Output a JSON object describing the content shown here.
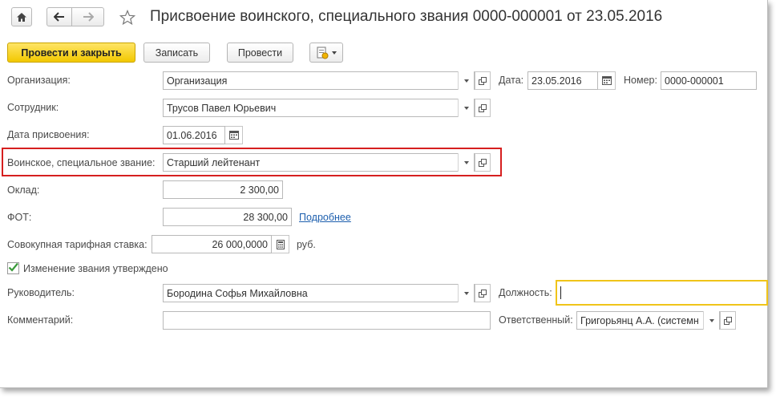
{
  "window": {
    "title": "Присвоение воинского, специального звания 0000-000001 от 23.05.2016"
  },
  "nav": {
    "home_icon": "home-icon",
    "back_icon": "arrow-left-icon",
    "forward_icon": "arrow-right-icon",
    "favorite_icon": "star-icon"
  },
  "toolbar": {
    "post_close_label": "Провести и закрыть",
    "save_label": "Записать",
    "post_label": "Провести",
    "reports_icon": "document-menu-icon"
  },
  "form": {
    "organization": {
      "label": "Организация:",
      "value": "Организация"
    },
    "date": {
      "label": "Дата:",
      "value": "23.05.2016"
    },
    "number": {
      "label": "Номер:",
      "value": "0000-000001"
    },
    "employee": {
      "label": "Сотрудник:",
      "value": "Трусов Павел Юрьевич"
    },
    "assign_date": {
      "label": "Дата присвоения:",
      "value": "01.06.2016"
    },
    "rank": {
      "label": "Воинское, специальное звание:",
      "value": "Старший лейтенант"
    },
    "salary": {
      "label": "Оклад:",
      "value": "2 300,00"
    },
    "fot": {
      "label": "ФОТ:",
      "value": "28 300,00",
      "link": "Подробнее"
    },
    "tariff": {
      "label": "Совокупная тарифная ставка:",
      "value": "26 000,0000",
      "unit": "руб."
    },
    "rank_change": {
      "label": "Изменение звания утверждено",
      "checked": true
    },
    "manager": {
      "label": "Руководитель:",
      "value": "Бородина Софья Михайловна"
    },
    "position": {
      "label": "Должность:",
      "value": ""
    },
    "comment": {
      "label": "Комментарий:",
      "value": ""
    },
    "responsible": {
      "label": "Ответственный:",
      "value": "Григорьянц А.А. (системн"
    }
  },
  "colors": {
    "accent_yellow": "#f5cd1b",
    "highlight_red": "#d61f1f",
    "link_blue": "#1d5fae",
    "focus_border": "#f0c419"
  }
}
